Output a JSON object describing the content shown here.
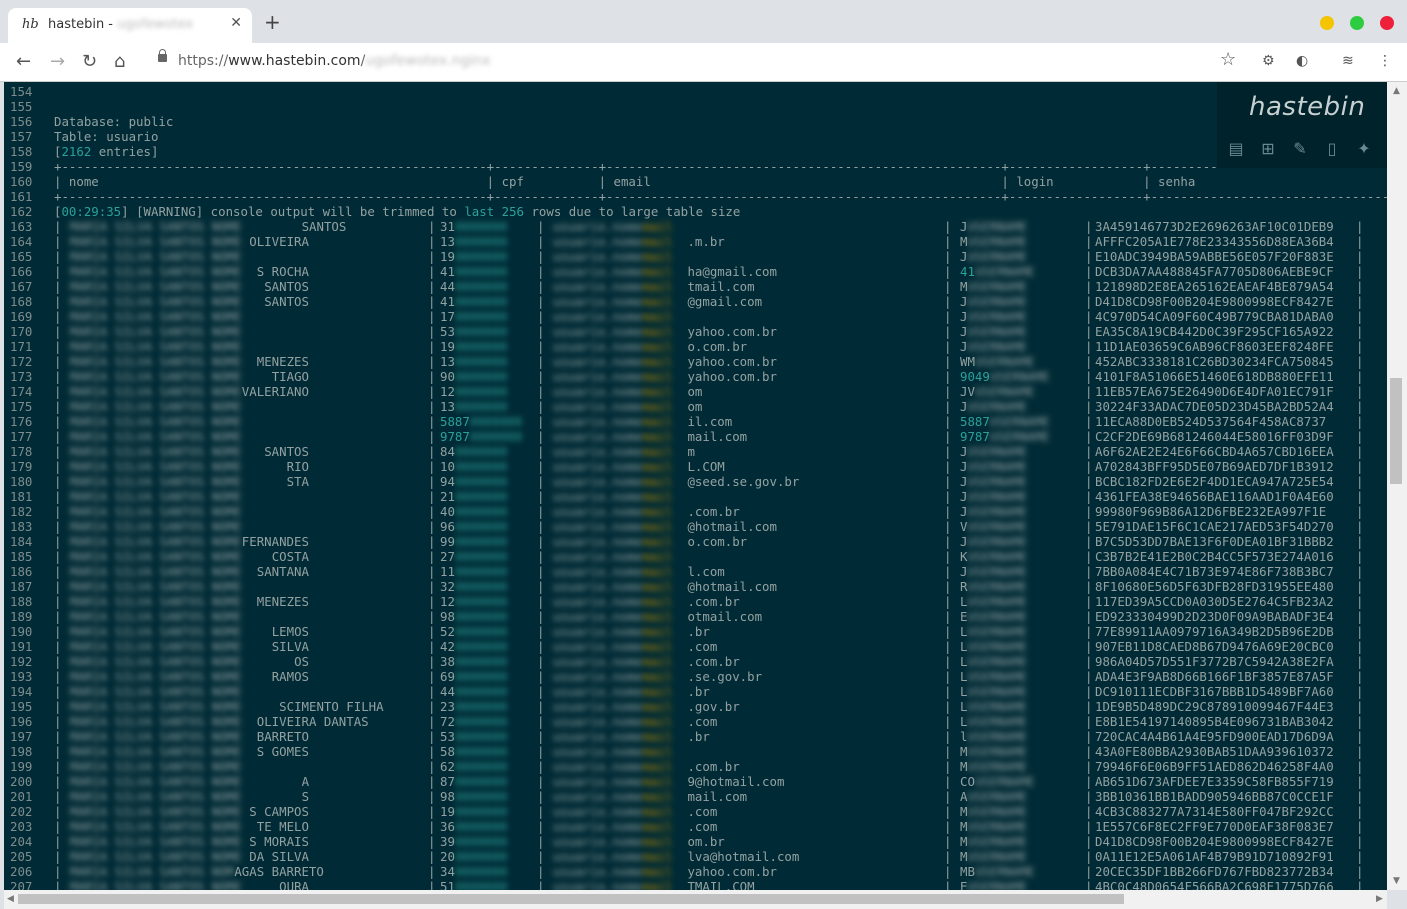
{
  "browser": {
    "tab_title": "hastebin - ",
    "tab_title_blurred": "ugofewotex",
    "tab_favicon": "hb",
    "url_prefix": "https://",
    "url_domain": "www.hastebin.com",
    "url_path": "/",
    "url_path_blurred": "ugofewotex.nginx"
  },
  "hastebin": {
    "logo": "hastebin",
    "actions": [
      "save-icon",
      "new-icon",
      "edit-icon",
      "raw-icon",
      "twitter-icon"
    ]
  },
  "lines": [
    {
      "n": "154",
      "t": ""
    },
    {
      "n": "155",
      "t": ""
    },
    {
      "n": "156",
      "t": "Database: public"
    },
    {
      "n": "157",
      "t": "Table: usuario"
    },
    {
      "n": "158",
      "t": "[2162 entries]"
    },
    {
      "n": "159",
      "t": "+---------------------------------------------------------+--------------+-----------------------------------------------------+------------------+-------------------------------------+"
    },
    {
      "n": "160",
      "t": "| nome                                                    | cpf          | email                                               | login            | senha                               |"
    },
    {
      "n": "161",
      "t": "+---------------------------------------------------------+--------------+-----------------------------------------------------+------------------+-------------------------------------+"
    },
    {
      "n": "162",
      "t": "[00:29:35] [WARNING] console output will be trimmed to last 256 rows due to large table size"
    }
  ],
  "table_rows": [
    {
      "n": "163",
      "nome_v": "SANTOS",
      "nome_off": 31,
      "cpf_v": "31",
      "email_v": "",
      "login_v": "J",
      "senha": "3A459146773D2E2696263AF10C01DEB9"
    },
    {
      "n": "164",
      "nome_v": "OLIVEIRA",
      "nome_off": 24,
      "cpf_v": "13",
      "email_v": ".m.br",
      "login_v": "M",
      "senha": "AFFFC205A1E778E23343556D88EA36B4"
    },
    {
      "n": "165",
      "nome_v": "",
      "nome_off": 0,
      "cpf_v": "19",
      "email_v": "",
      "login_v": "J",
      "senha": "E10ADC3949BA59ABBE56E057F20F883E"
    },
    {
      "n": "166",
      "nome_v": "S ROCHA",
      "nome_off": 25,
      "cpf_v": "41",
      "email_v": "ha@gmail.com",
      "login_v": "41",
      "senha": "DCB3DA7AA488845FA7705D806AEBE9CF"
    },
    {
      "n": "167",
      "nome_v": "SANTOS",
      "nome_off": 26,
      "cpf_v": "44",
      "email_v": "tmail.com",
      "login_v": "M",
      "senha": "121898D2E8EA265162EAEAF4BE879A54"
    },
    {
      "n": "168",
      "nome_v": "SANTOS",
      "nome_off": 26,
      "cpf_v": "41",
      "email_v": "@gmail.com",
      "login_v": "J",
      "senha": "D41D8CD98F00B204E9800998ECF8427E"
    },
    {
      "n": "169",
      "nome_v": "",
      "nome_off": 0,
      "cpf_v": "17",
      "email_v": "",
      "login_v": "J",
      "senha": "4C970D54CA09F60C49B779CBA81DABA0"
    },
    {
      "n": "170",
      "nome_v": "",
      "nome_off": 0,
      "cpf_v": "53",
      "email_v": "yahoo.com.br",
      "login_v": "J",
      "senha": "EA35C8A19CB442D0C39F295CF165A922"
    },
    {
      "n": "171",
      "nome_v": "",
      "nome_off": 0,
      "cpf_v": "19",
      "email_v": "o.com.br",
      "login_v": "J",
      "senha": "11D1AE03659C6AB96CF8603EEF8248FE"
    },
    {
      "n": "172",
      "nome_v": "MENEZES",
      "nome_off": 25,
      "cpf_v": "13",
      "email_v": "yahoo.com.br",
      "login_v": "WM",
      "senha": "452ABC3338181C26BD30234FCA750845"
    },
    {
      "n": "173",
      "nome_v": "TIAGO",
      "nome_off": 27,
      "cpf_v": "90",
      "email_v": "yahoo.com.br",
      "login_v": "9049",
      "senha": "4101F8A51066E51460E618DB880EFE11"
    },
    {
      "n": "174",
      "nome_v": "VALERIANO",
      "nome_off": 23,
      "cpf_v": "12",
      "email_v": "om",
      "login_v": "JV",
      "senha": "11EB57EA675E26490D6E4DFA01EC791F"
    },
    {
      "n": "175",
      "nome_v": "",
      "nome_off": 0,
      "cpf_v": "13",
      "email_v": "om",
      "login_v": "J",
      "senha": "30224F33ADAC7DE05D23D45BA2BD52A4"
    },
    {
      "n": "176",
      "nome_v": "",
      "nome_off": 0,
      "cpf_v": "5887",
      "email_v": "il.com",
      "login_v": "5887",
      "senha": "11ECA88D0EB524D537564F458AC8737"
    },
    {
      "n": "177",
      "nome_v": "",
      "nome_off": 0,
      "cpf_v": "9787",
      "email_v": "mail.com",
      "login_v": "9787",
      "senha": "C2CF2DE69B681246044E58016FF03D9F"
    },
    {
      "n": "178",
      "nome_v": "SANTOS",
      "nome_off": 26,
      "cpf_v": "84",
      "email_v": "m",
      "login_v": "J",
      "senha": "A6F62AE2E24E6F66CBD4A657CBD16EEA"
    },
    {
      "n": "179",
      "nome_v": "RIO",
      "nome_off": 29,
      "cpf_v": "10",
      "email_v": "L.COM",
      "login_v": "J",
      "senha": "A702843BFF95D5E07B69AED7DF1B3912"
    },
    {
      "n": "180",
      "nome_v": "STA",
      "nome_off": 29,
      "cpf_v": "94",
      "email_v": "@seed.se.gov.br",
      "login_v": "J",
      "senha": "BCBC182FD2E6E2F4DD1ECA947A725E54"
    },
    {
      "n": "181",
      "nome_v": "",
      "nome_off": 0,
      "cpf_v": "21",
      "email_v": "",
      "login_v": "J",
      "senha": "4361FEA38E94656BAE116AAD1F0A4E60"
    },
    {
      "n": "182",
      "nome_v": "",
      "nome_off": 0,
      "cpf_v": "40",
      "email_v": ".com.br",
      "login_v": "J",
      "senha": "99980F969B86A12D6FBE232EA997F1E"
    },
    {
      "n": "183",
      "nome_v": "",
      "nome_off": 0,
      "cpf_v": "96",
      "email_v": "@hotmail.com",
      "login_v": "V",
      "senha": "5E791DAE15F6C1CAE217AED53F54D270"
    },
    {
      "n": "184",
      "nome_v": "FERNANDES",
      "nome_off": 23,
      "cpf_v": "99",
      "email_v": "o.com.br",
      "login_v": "J",
      "senha": "B7C5D53DD7BAE13F6F0DEA01BF31BBB2"
    },
    {
      "n": "185",
      "nome_v": "COSTA",
      "nome_off": 27,
      "cpf_v": "27",
      "email_v": "",
      "login_v": "K",
      "senha": "C3B7B2E41E2B0C2B4CC5F573E274A016"
    },
    {
      "n": "186",
      "nome_v": "SANTANA",
      "nome_off": 25,
      "cpf_v": "11",
      "email_v": "l.com",
      "login_v": "J",
      "senha": "7BB0A084E4C71B73E974E86F738B3BC7"
    },
    {
      "n": "187",
      "nome_v": "",
      "nome_off": 0,
      "cpf_v": "32",
      "email_v": "@hotmail.com",
      "login_v": "R",
      "senha": "8F10680E56D5F63DFB28FD31955EE480"
    },
    {
      "n": "188",
      "nome_v": "MENEZES",
      "nome_off": 25,
      "cpf_v": "12",
      "email_v": ".com.br",
      "login_v": "L",
      "senha": "117ED39A5CCD0A030D5E2764C5FB23A2"
    },
    {
      "n": "189",
      "nome_v": "",
      "nome_off": 0,
      "cpf_v": "98",
      "email_v": "otmail.com",
      "login_v": "E",
      "senha": "ED923330499D2D23D0F09A9BABADF3E4"
    },
    {
      "n": "190",
      "nome_v": "LEMOS",
      "nome_off": 27,
      "cpf_v": "52",
      "email_v": ".br",
      "login_v": "L",
      "senha": "77E89911AA0979716A349B2D5B96E2DB"
    },
    {
      "n": "191",
      "nome_v": "SILVA",
      "nome_off": 27,
      "cpf_v": "42",
      "email_v": ".com",
      "login_v": "L",
      "senha": "907EB11D8CAED8B67D9476A69E20CBC0"
    },
    {
      "n": "192",
      "nome_v": "OS",
      "nome_off": 30,
      "cpf_v": "38",
      "email_v": ".com.br",
      "login_v": "L",
      "senha": "986A04D57D551F3772B7C5942A38E2FA"
    },
    {
      "n": "193",
      "nome_v": "RAMOS",
      "nome_off": 27,
      "cpf_v": "69",
      "email_v": ".se.gov.br",
      "login_v": "L",
      "senha": "ADA4E3F9AB8D66B166F1BF3857E87A5F"
    },
    {
      "n": "194",
      "nome_v": "",
      "nome_off": 0,
      "cpf_v": "44",
      "email_v": ".br",
      "login_v": "L",
      "senha": "DC910111ECDBF3167BBB1D5489BF7A60"
    },
    {
      "n": "195",
      "nome_v": "SCIMENTO FILHA",
      "nome_off": 28,
      "cpf_v": "23",
      "email_v": ".gov.br",
      "login_v": "L",
      "senha": "1DE9B5D489DC29C878910099467F44E3"
    },
    {
      "n": "196",
      "nome_v": "OLIVEIRA DANTAS",
      "nome_off": 25,
      "cpf_v": "72",
      "email_v": ".com",
      "login_v": "L",
      "senha": "E8B1E54197140895B4E096731BAB3042"
    },
    {
      "n": "197",
      "nome_v": "BARRETO",
      "nome_off": 25,
      "cpf_v": "53",
      "email_v": ".br",
      "login_v": "l",
      "senha": "720CAC4A4B61A4E95FD900EAD17D6D9A"
    },
    {
      "n": "198",
      "nome_v": "S GOMES",
      "nome_off": 25,
      "cpf_v": "58",
      "email_v": "",
      "login_v": "M",
      "senha": "43A0FE80BBA2930BAB51DAA939610372"
    },
    {
      "n": "199",
      "nome_v": "",
      "nome_off": 0,
      "cpf_v": "62",
      "email_v": ".com.br",
      "login_v": "M",
      "senha": "79946F6E06B9FF51AED862D46258F4A0"
    },
    {
      "n": "200",
      "nome_v": "A",
      "nome_off": 31,
      "cpf_v": "87",
      "email_v": "9@hotmail.com",
      "login_v": "CO",
      "senha": "AB651D673AFDEE7E3359C58FB855F719"
    },
    {
      "n": "201",
      "nome_v": "S",
      "nome_off": 31,
      "cpf_v": "98",
      "email_v": "mail.com",
      "login_v": "A",
      "senha": "3BB10361BB1BADD905946BB87C0CCE1F"
    },
    {
      "n": "202",
      "nome_v": "S CAMPOS",
      "nome_off": 24,
      "cpf_v": "19",
      "email_v": ".com",
      "login_v": "M",
      "senha": "4CB3C883277A7314E580FF047BF292CC"
    },
    {
      "n": "203",
      "nome_v": "TE MELO",
      "nome_off": 25,
      "cpf_v": "36",
      "email_v": ".com",
      "login_v": "M",
      "senha": "1E557C6F8EC2FF9E770D0EAF38F083E7"
    },
    {
      "n": "204",
      "nome_v": "S MORAIS",
      "nome_off": 24,
      "cpf_v": "39",
      "email_v": "om.br",
      "login_v": "M",
      "senha": "D41D8CD98F00B204E9800998ECF8427E"
    },
    {
      "n": "205",
      "nome_v": "DA SILVA",
      "nome_off": 24,
      "cpf_v": "20",
      "email_v": "lva@hotmail.com",
      "login_v": "M",
      "senha": "0A11E12E5A061AF4B79B91D710892F91"
    },
    {
      "n": "206",
      "nome_v": "AGAS BARRETO",
      "nome_off": 22,
      "cpf_v": "34",
      "email_v": "yahoo.com.br",
      "login_v": "MB",
      "senha": "20CEC35DF1BB266FD767FBD823772B34"
    },
    {
      "n": "207",
      "nome_v": "OURA",
      "nome_off": 28,
      "cpf_v": "51",
      "email_v": "TMAIL.COM",
      "login_v": "E",
      "senha": "4BC0C48D0654F566BA2C698E1775D766"
    }
  ]
}
